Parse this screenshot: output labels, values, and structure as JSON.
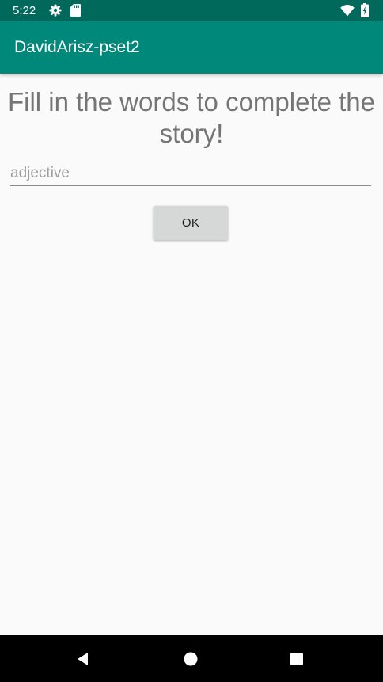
{
  "status_bar": {
    "time": "5:22",
    "icons": [
      "gear-icon",
      "sd-card-icon",
      "wifi-icon",
      "battery-charging-icon"
    ],
    "background": "#00695c"
  },
  "app_bar": {
    "title": "DavidArisz-pset2",
    "background": "#00897b"
  },
  "main": {
    "heading": "Fill in the words to complete the story!",
    "word_input": {
      "value": "",
      "placeholder": "adjective"
    },
    "ok_button_label": "OK"
  },
  "nav_bar": {
    "buttons": [
      "back-icon",
      "home-icon",
      "recents-icon"
    ]
  }
}
